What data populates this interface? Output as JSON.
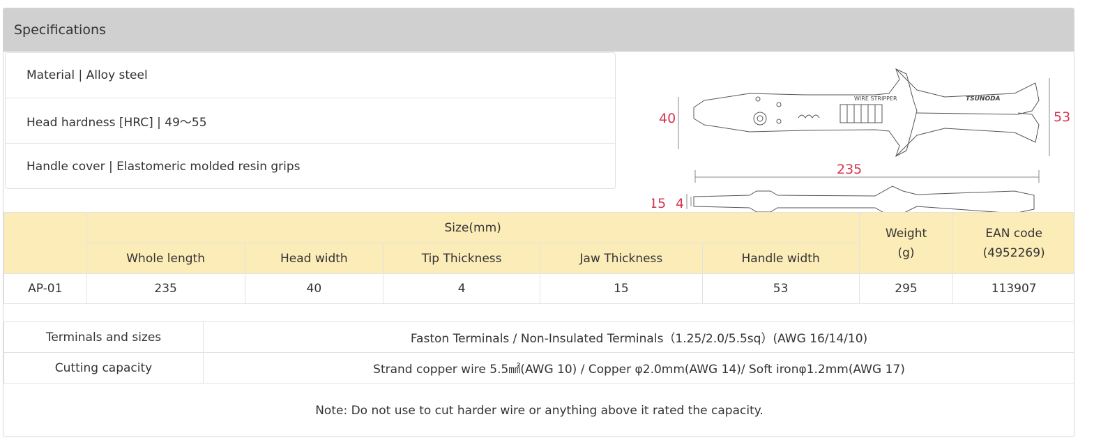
{
  "header": {
    "title": "Specifications"
  },
  "specs": [
    {
      "label": "Material | Alloy steel"
    },
    {
      "label": "Head hardness [HRC] | 49～55"
    },
    {
      "label": "Handle cover | Elastomeric molded resin grips"
    }
  ],
  "drawing": {
    "dim_head_width": "40",
    "dim_handle_width": "53",
    "dim_length": "235",
    "dim_jaw_thickness": "15",
    "dim_tip_thickness": "4",
    "stripper_label": "WIRE STRIPPER",
    "brand": "TSUNODA",
    "accent_color": "#d6344f"
  },
  "size_table": {
    "group_header": "Size(mm)",
    "columns": [
      "Whole length",
      "Head width",
      "Tip Thickness",
      "Jaw Thickness",
      "Handle width"
    ],
    "weight_header": "Weight",
    "weight_unit": "(g)",
    "ean_header": "EAN code",
    "ean_prefix": "(4952269)",
    "rows": [
      {
        "model": "AP-01",
        "values": [
          "235",
          "40",
          "4",
          "15",
          "53"
        ],
        "weight": "295",
        "ean": "113907"
      }
    ]
  },
  "details": [
    {
      "label": "Terminals and sizes",
      "value": "Faston Terminals / Non-Insulated Terminals（1.25/2.0/5.5sq）(AWG 16/14/10)"
    },
    {
      "label": "Cutting capacity",
      "value": "Strand copper wire 5.5㎟(AWG 10) / Copper φ2.0mm(AWG 14)/ Soft ironφ1.2mm(AWG 17)"
    }
  ],
  "note": "Note: Do not use to cut harder wire or anything above it rated the capacity."
}
